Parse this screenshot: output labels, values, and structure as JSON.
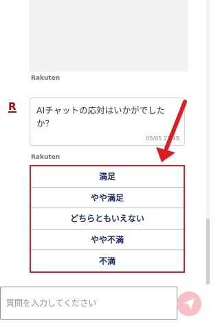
{
  "messages": {
    "sender_top": "Rakuten",
    "sender_bottom": "Rakuten",
    "bot_logo": "R",
    "bot_text": "AIチャットの応対はいかがでしたか？",
    "bot_time": "05/05 22:18"
  },
  "survey": {
    "options": [
      "満足",
      "やや満足",
      "どちらともいえない",
      "やや不満",
      "不満"
    ]
  },
  "input": {
    "placeholder": "質問を入力してください",
    "value": ""
  },
  "icons": {
    "send": "send-icon",
    "arrow": "red-arrow-annotation"
  },
  "colors": {
    "brand_red": "#bf0000",
    "highlight_red": "#e11b22",
    "option_text": "#1f2c6b",
    "send_button": "#f7c0c4"
  }
}
